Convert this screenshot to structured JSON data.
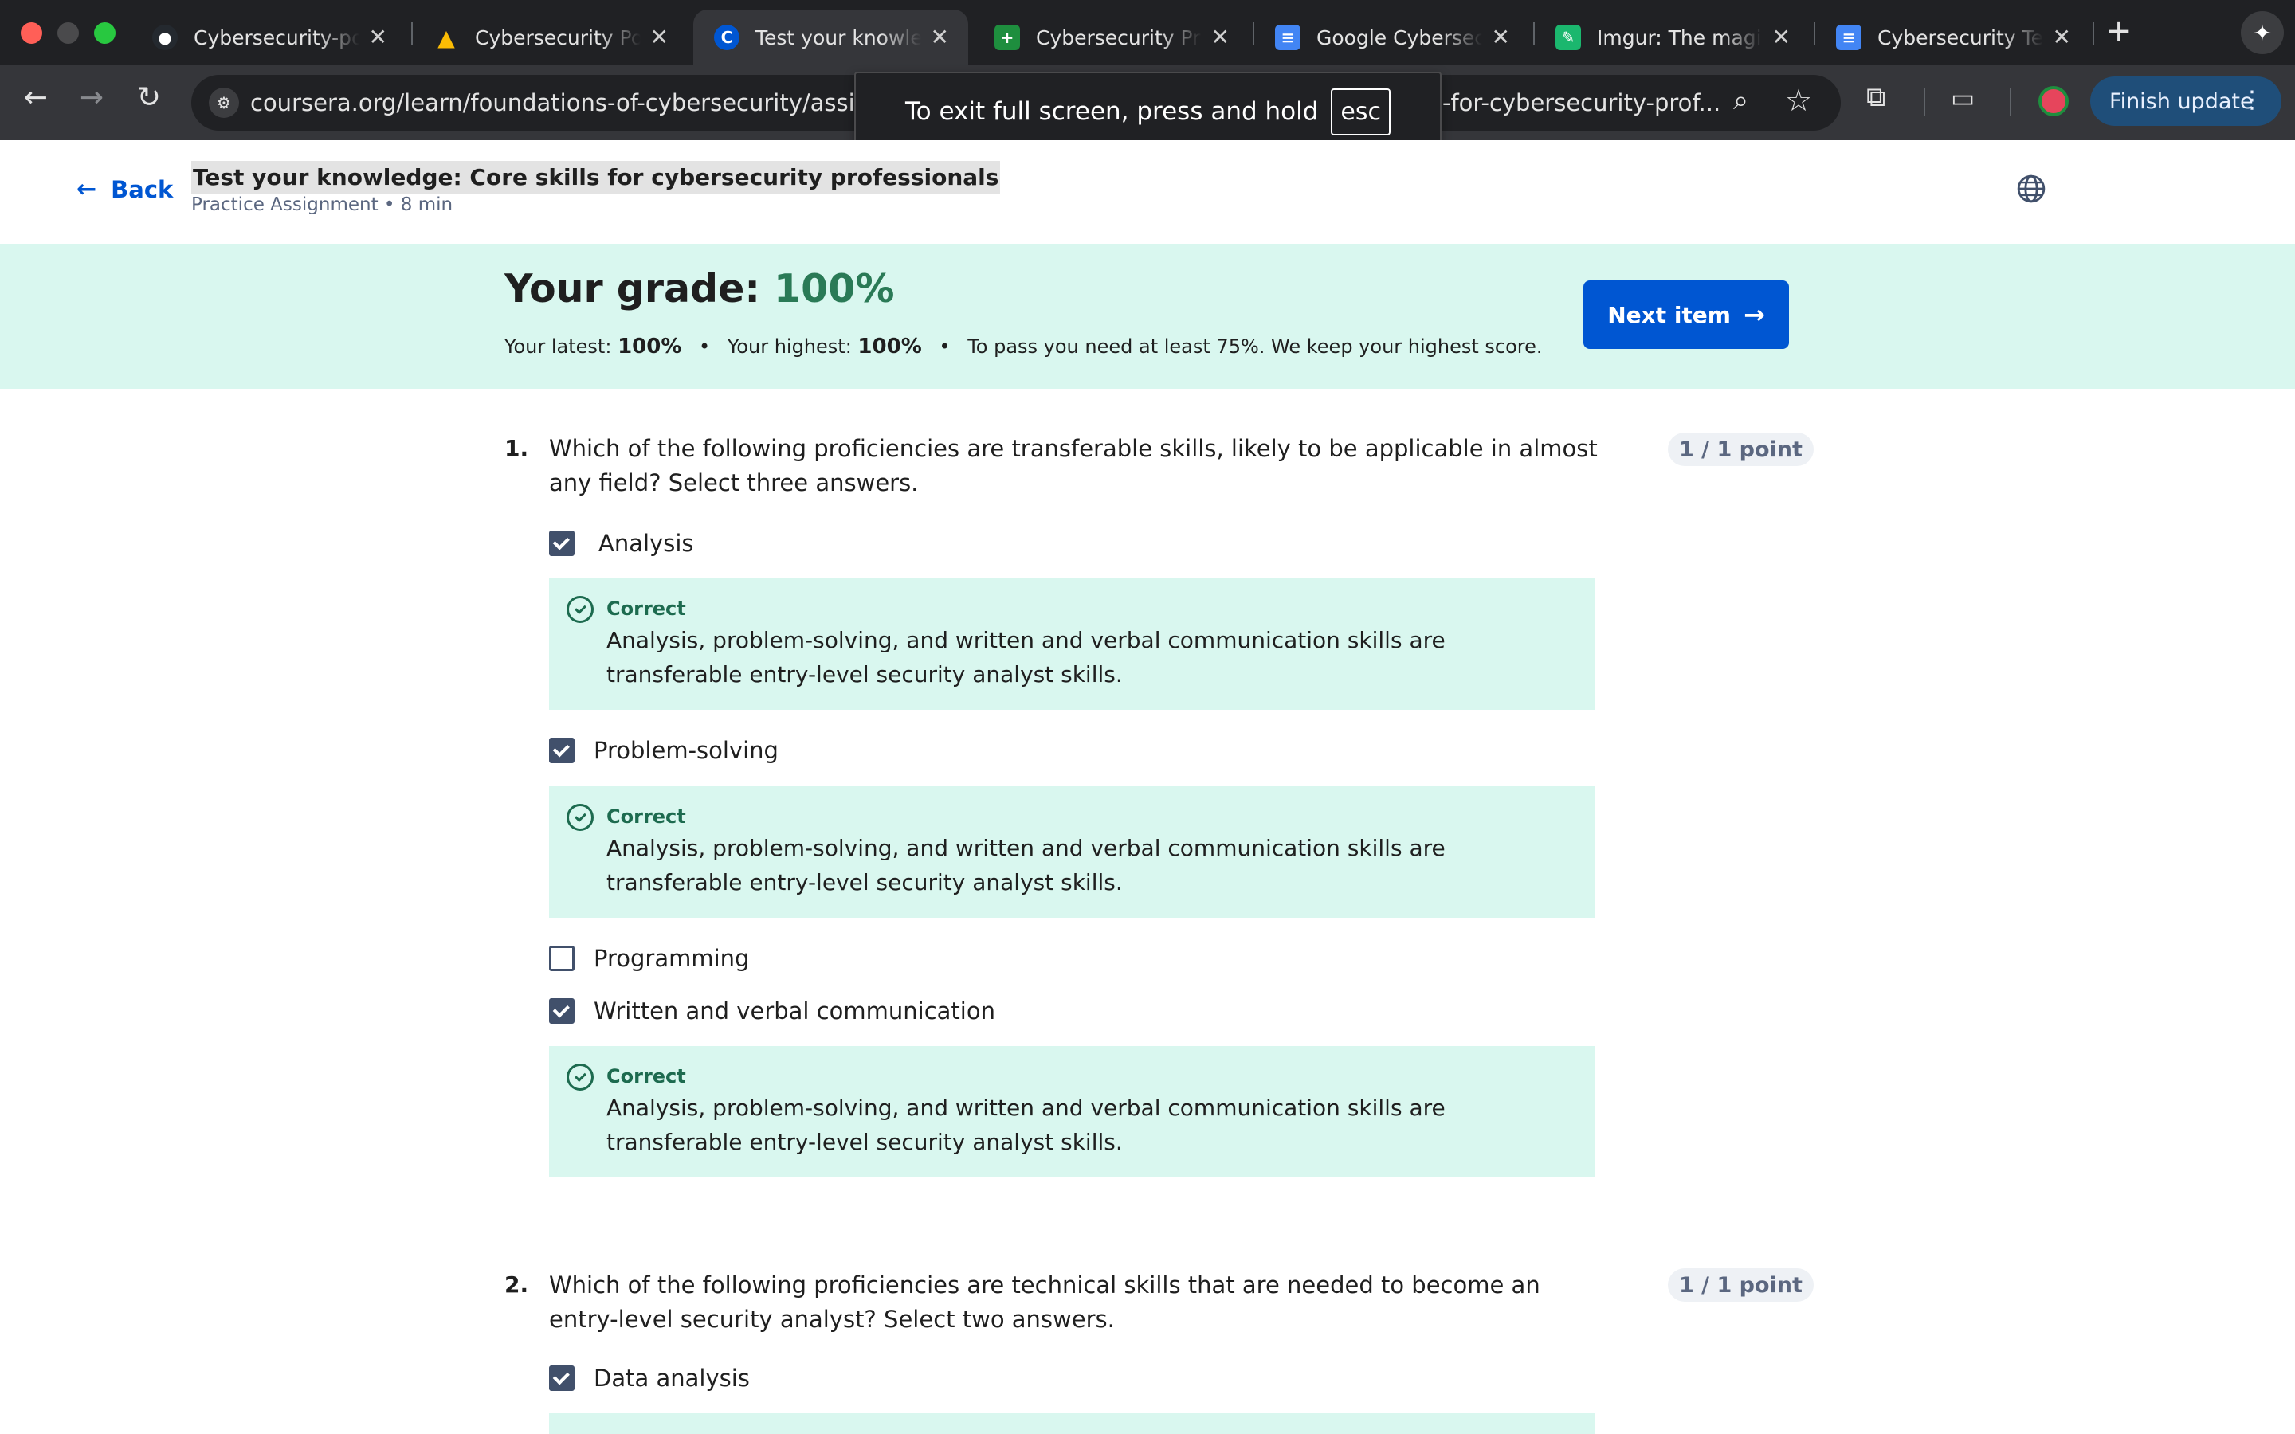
{
  "browser": {
    "tabs": [
      {
        "title": "Cybersecurity-portfolio",
        "icon": "github-icon",
        "color": "#24292f",
        "glyph": "●"
      },
      {
        "title": "Cybersecurity Portfolio",
        "icon": "google-drive-icon",
        "color": "#1a73e8",
        "glyph": "▲"
      },
      {
        "title": "Test your knowledge",
        "icon": "coursera-icon",
        "color": "#0056d2",
        "glyph": "C"
      },
      {
        "title": "Cybersecurity Program",
        "icon": "google-sheets-icon",
        "color": "#1e8e3e",
        "glyph": "+"
      },
      {
        "title": "Google Cybersecurity",
        "icon": "google-docs-icon",
        "color": "#4285f4",
        "glyph": "≡"
      },
      {
        "title": "Imgur: The magic of the Internet",
        "icon": "imgur-icon",
        "color": "#1bb76e",
        "glyph": "✎"
      },
      {
        "title": "Cybersecurity Terms",
        "icon": "google-docs-icon",
        "color": "#4285f4",
        "glyph": "≡"
      }
    ],
    "url_left": "coursera.org/learn/foundations-of-cybersecurity/assignm",
    "url_right": "-for-cybersecurity-prof...",
    "finish_update": "Finish update",
    "fullscreen_toast": "To exit full screen, press and hold",
    "fullscreen_key": "esc"
  },
  "header": {
    "back_label": "Back",
    "title": "Test your knowledge: Core skills for cybersecurity professionals",
    "meta": "Practice Assignment • 8 min"
  },
  "grade": {
    "heading": "Your grade:",
    "value": "100%",
    "latest_label": "Your latest:",
    "latest_value": "100%",
    "highest_label": "Your highest:",
    "highest_value": "100%",
    "pass_note": "To pass you need at least 75%. We keep your highest score.",
    "next_label": "Next item"
  },
  "questions": [
    {
      "number": "1.",
      "text": "Which of the following proficiencies are transferable skills, likely to be applicable in almost any field? Select three answers.",
      "points": "1 / 1 point",
      "options": [
        {
          "label": "Analysis",
          "checked": true
        },
        {
          "label": "Problem-solving",
          "checked": true
        },
        {
          "label": "Programming",
          "checked": false
        },
        {
          "label": "Written and verbal communication",
          "checked": true
        }
      ],
      "feedback": {
        "label": "Correct",
        "text": "Analysis, problem-solving, and written and verbal communication skills are transferable entry-level security analyst skills."
      }
    },
    {
      "number": "2.",
      "text": "Which of the following proficiencies are technical skills that are needed to become an entry-level security analyst? Select two answers.",
      "points": "1 / 1 point",
      "options": [
        {
          "label": "Data analysis",
          "checked": true
        }
      ]
    }
  ]
}
